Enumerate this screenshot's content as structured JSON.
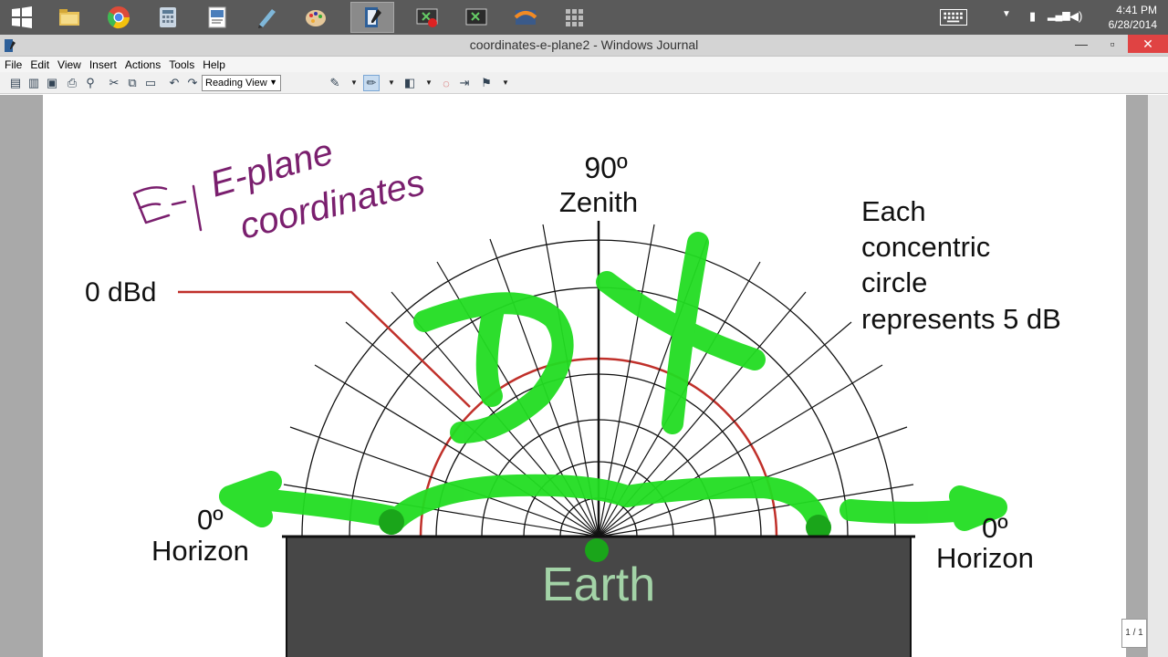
{
  "taskbar": {
    "clock_time": "4:41 PM",
    "clock_date": "6/28/2014",
    "icons": [
      "windows-start-icon",
      "file-explorer-icon",
      "chrome-icon",
      "calculator-icon",
      "word-icon",
      "writing-tool-icon",
      "paint-icon",
      "journal-icon",
      "screen-recorder-icon",
      "video-player-icon",
      "firefox-icon",
      "app-grid-icon"
    ]
  },
  "window": {
    "title": "coordinates-e-plane2 - Windows Journal",
    "minimize": "—",
    "maximize": "▫",
    "close": "✕"
  },
  "menu": {
    "file": "File",
    "edit": "Edit",
    "view": "View",
    "insert": "Insert",
    "actions": "Actions",
    "tools": "Tools",
    "help": "Help"
  },
  "toolbar": {
    "view_mode": "Reading View"
  },
  "diagram": {
    "handwritten_title_line1": "E-plane",
    "handwritten_title_line2": "coordinates",
    "top_angle": "90º",
    "top_label": "Zenith",
    "left_angle": "0º",
    "left_label": "Horizon",
    "right_angle": "0º",
    "right_label": "Horizon",
    "reference_label": "0 dBd",
    "note_line1": "Each",
    "note_line2": "concentric",
    "note_line3": "circle",
    "note_line4": "represents 5 dB",
    "ground_label": "Earth",
    "handwritten_annotation": "DX"
  },
  "status": {
    "page_indicator": "1 / 1"
  },
  "colors": {
    "taskbar": "#5a5a5a",
    "ink_purple": "#7a1f6e",
    "highlighter_green": "#22dd22",
    "reference_circle": "#c0302a",
    "earth_fill": "#474747",
    "earth_text": "#a3d3a7",
    "close_button": "#e04343"
  }
}
